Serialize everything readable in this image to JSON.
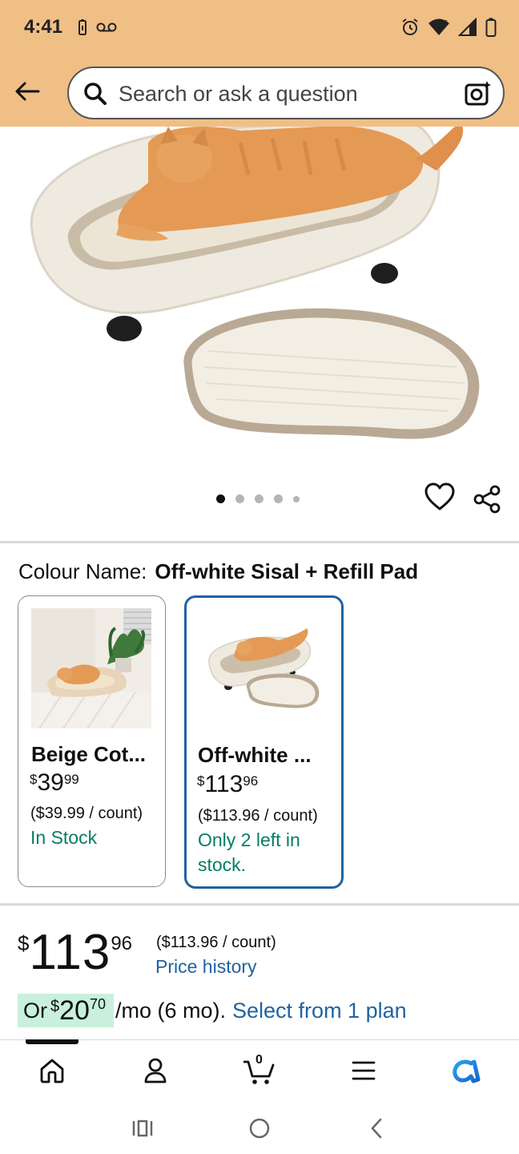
{
  "status_bar": {
    "time": "4:41"
  },
  "search": {
    "placeholder": "Search or ask a question"
  },
  "gallery": {
    "image_count": 5,
    "active_index": 0
  },
  "colour": {
    "label": "Colour Name:",
    "value": "Off-white Sisal + Refill Pad"
  },
  "swatches": [
    {
      "title": "Beige Cot...",
      "price_symbol": "$",
      "price_whole": "39",
      "price_fraction": "99",
      "unit_price": "($39.99 / count)",
      "availability": "In Stock",
      "selected": false
    },
    {
      "title": "Off-white ...",
      "price_symbol": "$",
      "price_whole": "113",
      "price_fraction": "96",
      "unit_price": "($113.96 / count)",
      "availability": "Only 2 left in stock.",
      "selected": true
    }
  ],
  "price": {
    "symbol": "$",
    "whole": "113",
    "fraction": "96",
    "unit_price": "($113.96 / count)",
    "history_link": "Price history"
  },
  "monthly": {
    "prefix": "Or",
    "symbol": "$",
    "whole": "20",
    "fraction": "70",
    "term": "/mo (6 mo).",
    "plan_link": "Select from 1 plan"
  },
  "bottom_nav": {
    "cart_count": "0"
  },
  "colors": {
    "header_bg": "#f0bf86",
    "link_blue": "#2162a1",
    "stock_green": "#067d62",
    "monthly_highlight": "#c8f0dc",
    "selected_border": "#2162a1"
  }
}
